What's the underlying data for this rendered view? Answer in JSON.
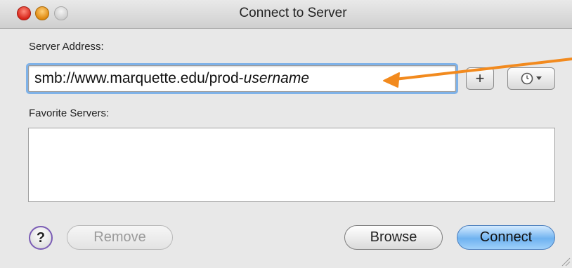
{
  "window": {
    "title": "Connect to Server"
  },
  "server_address": {
    "label": "Server Address:",
    "value_prefix": "smb://www.marquette.edu/prod-",
    "value_placeholder_part": "username"
  },
  "favorites": {
    "label": "Favorite Servers:",
    "items": []
  },
  "buttons": {
    "add_label": "+",
    "recent_label": "recent-servers-clock-icon",
    "help_label": "?",
    "remove_label": "Remove",
    "browse_label": "Browse",
    "connect_label": "Connect"
  },
  "colors": {
    "annotation_arrow": "#f28a1e",
    "focus_ring": "#7fb2e8",
    "connect_button": "#6fb2f0",
    "help_ring": "#7a5cb5"
  }
}
